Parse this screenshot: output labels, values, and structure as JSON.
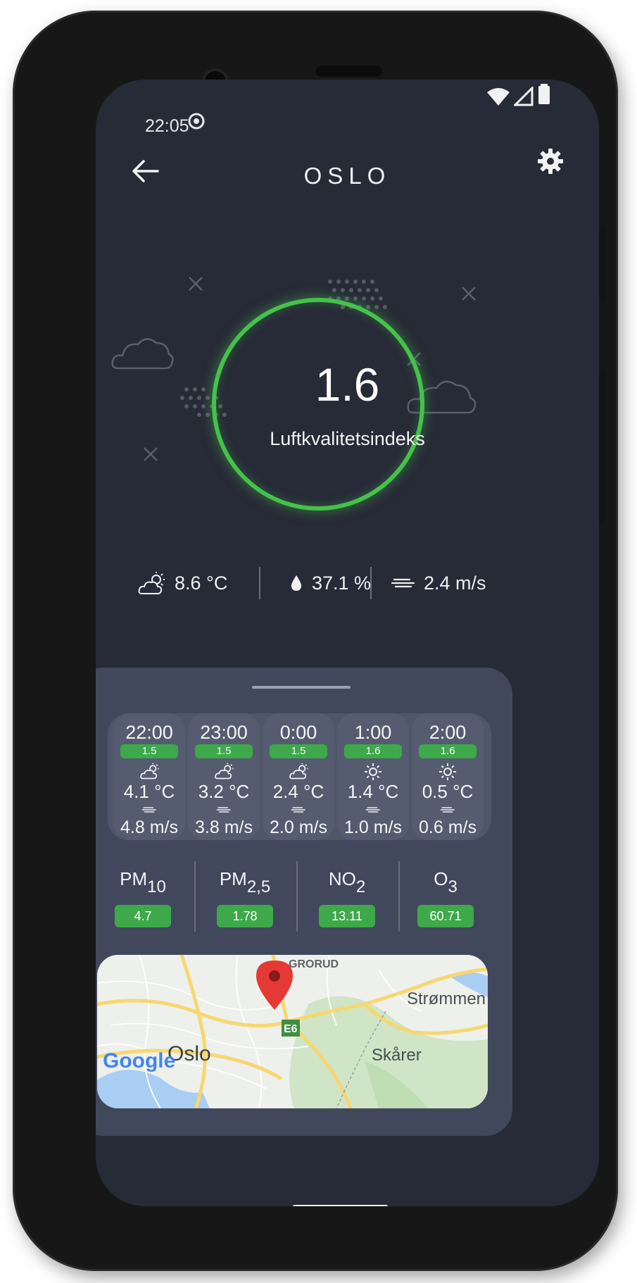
{
  "status_bar": {
    "time": "22:05",
    "icons": [
      "sync-icon",
      "wifi-icon",
      "signal-icon",
      "battery-icon"
    ]
  },
  "header": {
    "title": "OSLO",
    "back_icon": "arrow-left-icon",
    "settings_icon": "gear-icon"
  },
  "aqi": {
    "value": "1.6",
    "label": "Luftkvalitetsindeks",
    "ring_color": "#45c24a"
  },
  "current_weather": {
    "temperature": "8.6 °C",
    "humidity": "37.1 %",
    "wind": "2.4 m/s",
    "temperature_icon": "partly-cloudy-icon",
    "humidity_icon": "droplet-icon",
    "wind_icon": "wind-icon"
  },
  "forecast": [
    {
      "time": "22:00",
      "aqi": "1.5",
      "icon": "partly-cloudy-icon",
      "temp": "4.1 °C",
      "wind": "4.8 m/s"
    },
    {
      "time": "23:00",
      "aqi": "1.5",
      "icon": "partly-cloudy-icon",
      "temp": "3.2 °C",
      "wind": "3.8 m/s"
    },
    {
      "time": "0:00",
      "aqi": "1.5",
      "icon": "partly-cloudy-icon",
      "temp": "2.4 °C",
      "wind": "2.0 m/s"
    },
    {
      "time": "1:00",
      "aqi": "1.6",
      "icon": "sun-icon",
      "temp": "1.4 °C",
      "wind": "1.0 m/s"
    },
    {
      "time": "2:00",
      "aqi": "1.6",
      "icon": "sun-icon",
      "temp": "0.5 °C",
      "wind": "0.6 m/s"
    }
  ],
  "pollutants": [
    {
      "base": "PM",
      "sub": "10",
      "value": "4.7"
    },
    {
      "base": "PM",
      "sub": "2,5",
      "value": "1.78"
    },
    {
      "base": "NO",
      "sub": "2",
      "value": "13.11"
    },
    {
      "base": "O",
      "sub": "3",
      "value": "60.71"
    }
  ],
  "map": {
    "labels": {
      "grorud": "GRORUD",
      "strommen": "Strømmen",
      "oslo": "Oslo",
      "skarer": "Skårer",
      "road": "E6"
    },
    "attribution": "Google",
    "pin_color": "#e53935"
  },
  "colors": {
    "background": "#272a37",
    "sheet": "#41485c",
    "badge_green": "#3ea94a"
  }
}
